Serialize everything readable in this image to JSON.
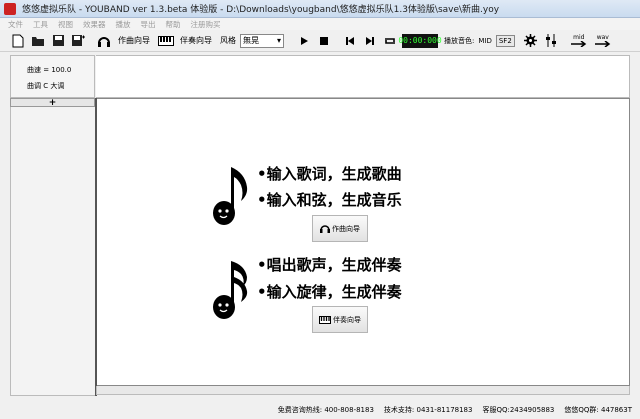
{
  "window": {
    "title": "悠悠虚拟乐队 - YOUBAND ver 1.3.beta 体验版  - D:\\Downloads\\yougband\\悠悠虚拟乐队1.3体验版\\save\\新曲.yoy"
  },
  "menu": [
    "文件",
    "工具",
    "视图",
    "效果器",
    "播放",
    "导出",
    "帮助",
    "注册购买"
  ],
  "toolbar": {
    "compose_wizard": "作曲向导",
    "accompany_wizard": "伴奏向导",
    "style_label": "风格",
    "style_value": "無晃",
    "time": "00:00:000",
    "play_color_label": "播放音色:",
    "mid_label": "MID",
    "sf2_label": "SF2",
    "mid_export": "mid",
    "wav_export": "wav"
  },
  "info": {
    "tempo": "曲速 = 100.0",
    "key": "曲调  C  大调"
  },
  "track": {
    "add_label": "+"
  },
  "main": {
    "line1": "•输入歌词，生成歌曲",
    "line2": "•输入和弦，生成音乐",
    "compose_button": "作曲向导",
    "line3": "•唱出歌声，生成伴奏",
    "line4": "•输入旋律，生成伴奏",
    "accompany_button": "伴奏向导"
  },
  "status": {
    "hotline": "免费咨询热线: 400-808-8183",
    "support": "技术支持: 0431-81178183",
    "service_qq": "客服QQ:2434905883",
    "qq_group": "悠悠QQ群: 447863T"
  }
}
